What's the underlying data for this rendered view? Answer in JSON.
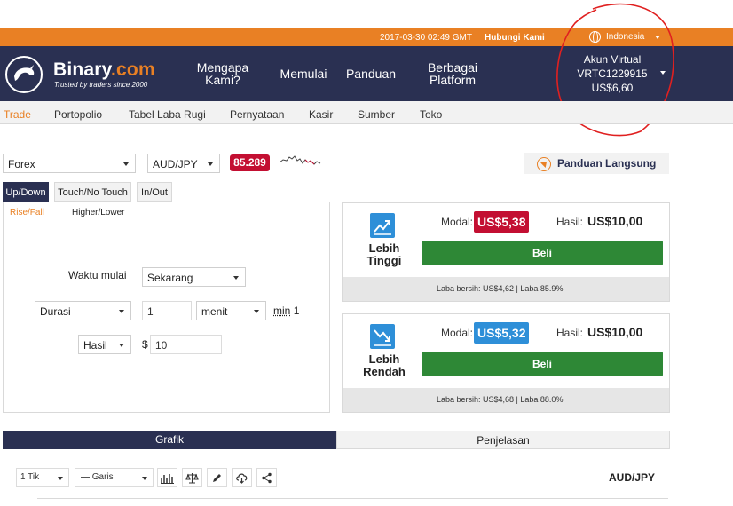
{
  "topbar": {
    "time": "2017-03-30 02:49 GMT",
    "contact": "Hubungi Kami",
    "language": "Indonesia"
  },
  "brand": {
    "name_main": "Binary",
    "name_suffix": ".com",
    "tagline": "Trusted by traders since 2000"
  },
  "nav": {
    "why": "Mengapa Kami?",
    "start": "Memulai",
    "guide": "Panduan",
    "platforms": "Berbagai Platform"
  },
  "account": {
    "label": "Akun Virtual",
    "id": "VRTC1229915",
    "balance": "US$6,60"
  },
  "menu": [
    "Trade",
    "Portopolio",
    "Tabel Laba Rugi",
    "Pernyataan",
    "Kasir",
    "Sumber",
    "Toko"
  ],
  "market": {
    "category": "Forex",
    "symbol": "AUD/JPY",
    "price": "85.289"
  },
  "live_guide": "Panduan Langsung",
  "contract_tabs": [
    "Up/Down",
    "Touch/No Touch",
    "In/Out"
  ],
  "sub_tabs": [
    "Rise/Fall",
    "Higher/Lower"
  ],
  "form": {
    "start_label": "Waktu mulai",
    "start_value": "Sekarang",
    "duration_type": "Durasi",
    "duration_value": "1",
    "duration_unit": "menit",
    "min_label": "min",
    "min_value": "1",
    "payout_type": "Hasil",
    "currency": "$",
    "amount": "10"
  },
  "contracts": [
    {
      "name": "Lebih Tinggi",
      "modal_label": "Modal:",
      "modal_value": "US$5,38",
      "modal_color": "#c30f32",
      "payout_label": "Hasil:",
      "payout_value": "US$10,00",
      "buy_label": "Beli",
      "net": "Laba bersih: US$4,62 | Laba 85.9%"
    },
    {
      "name": "Lebih Rendah",
      "modal_label": "Modal:",
      "modal_value": "US$5,32",
      "modal_color": "#2e8fd8",
      "payout_label": "Hasil:",
      "payout_value": "US$10,00",
      "buy_label": "Beli",
      "net": "Laba bersih: US$4,68 | Laba 88.0%"
    }
  ],
  "chart_tabs": [
    "Grafik",
    "Penjelasan"
  ],
  "chart_toolbar": {
    "interval": "1 Tik",
    "chart_type": "Garis",
    "pair": "AUD/JPY"
  },
  "colors": {
    "orange": "#e98024",
    "navy": "#2a3052",
    "green": "#2e8836",
    "red": "#c30f32",
    "blue": "#2e8fd8"
  }
}
